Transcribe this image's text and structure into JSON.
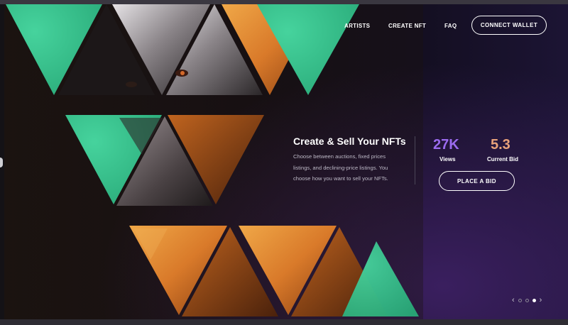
{
  "nav": {
    "items": [
      {
        "label": "ARTISTS"
      },
      {
        "label": "CREATE NFT"
      },
      {
        "label": "FAQ"
      }
    ],
    "cta_label": "CONNECT WALLET"
  },
  "hero": {
    "title": "Create & Sell Your NFTs",
    "description": "Choose between auctions, fixed prices listings, and declining-price listings. You choose how you want to sell your NFTs.",
    "stats": [
      {
        "value": "27K",
        "label": "Views",
        "color": "#9b6bf0"
      },
      {
        "value": "5.3",
        "label": "Current Bid",
        "color": "#e8a27a"
      }
    ],
    "bid_label": "PLACE A BID"
  },
  "carousel": {
    "slides": 3,
    "active_slide": 3,
    "prev_icon": "chevron-left-icon",
    "next_icon": "chevron-right-icon"
  },
  "colors": {
    "accent_green": "#37c08e",
    "accent_orange": "#e08a35",
    "views_purple": "#9b6bf0",
    "bid_peach": "#e8a27a"
  }
}
